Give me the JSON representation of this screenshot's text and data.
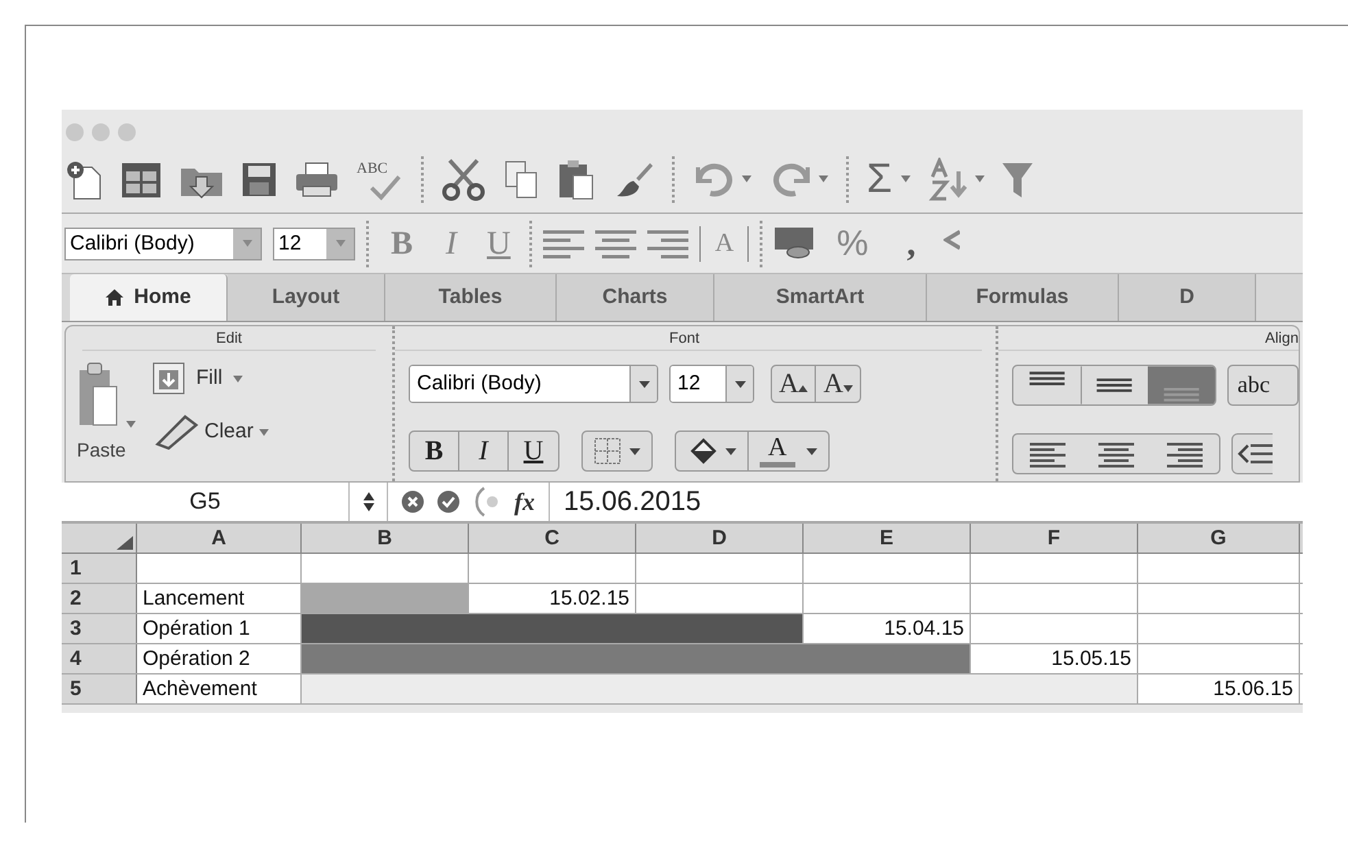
{
  "toolbar": {
    "spell_label": "ABC",
    "sum_label": "Σ"
  },
  "format_bar": {
    "font": "Calibri (Body)",
    "size": "12",
    "bold": "B",
    "italic": "I",
    "underline": "U",
    "merge_label": "A",
    "percent": "%",
    "comma": ","
  },
  "tabs": [
    {
      "label": "Home",
      "selected": true
    },
    {
      "label": "Layout",
      "selected": false
    },
    {
      "label": "Tables",
      "selected": false
    },
    {
      "label": "Charts",
      "selected": false
    },
    {
      "label": "SmartArt",
      "selected": false
    },
    {
      "label": "Formulas",
      "selected": false
    },
    {
      "label": "D",
      "selected": false
    }
  ],
  "ribbon": {
    "groups": [
      "Edit",
      "Font",
      "Align"
    ],
    "paste": "Paste",
    "fill": "Fill",
    "clear": "Clear",
    "font": "Calibri (Body)",
    "size": "12",
    "grow": "A",
    "shrink": "A",
    "bold": "B",
    "italic": "I",
    "underline": "U",
    "font_color": "A",
    "orientation": "abc"
  },
  "formula_bar": {
    "cell_ref": "G5",
    "fx": "fx",
    "value": "15.06.2015"
  },
  "sheet": {
    "columns": [
      "A",
      "B",
      "C",
      "D",
      "E",
      "F",
      "G"
    ],
    "rows": [
      {
        "header": "1",
        "cells": [
          {},
          {},
          {},
          {},
          {},
          {},
          {}
        ]
      },
      {
        "header": "2",
        "cells": [
          {
            "kind": "text",
            "text": "Lancement"
          },
          {
            "color": "#a8a8a8"
          },
          {
            "kind": "date",
            "text": "15.02.15"
          },
          {},
          {},
          {},
          {}
        ]
      },
      {
        "header": "3",
        "cells": [
          {
            "kind": "text",
            "text": "Opération 1"
          },
          {
            "color": "#555555"
          },
          {
            "color": "#555555"
          },
          {
            "color": "#555555"
          },
          {
            "kind": "date",
            "text": "15.04.15"
          },
          {},
          {}
        ]
      },
      {
        "header": "4",
        "cells": [
          {
            "kind": "text",
            "text": "Opération 2"
          },
          {
            "color": "#7a7a7a"
          },
          {
            "color": "#7a7a7a"
          },
          {
            "color": "#7a7a7a"
          },
          {
            "color": "#7a7a7a"
          },
          {
            "kind": "date",
            "text": "15.05.15"
          },
          {}
        ]
      },
      {
        "header": "5",
        "cells": [
          {
            "kind": "text",
            "text": "Achèvement"
          },
          {
            "color": "#ececec"
          },
          {
            "color": "#ececec"
          },
          {
            "color": "#ececec"
          },
          {
            "color": "#ececec"
          },
          {
            "color": "#ececec"
          },
          {
            "kind": "date",
            "text": "15.06.15"
          }
        ]
      }
    ]
  }
}
